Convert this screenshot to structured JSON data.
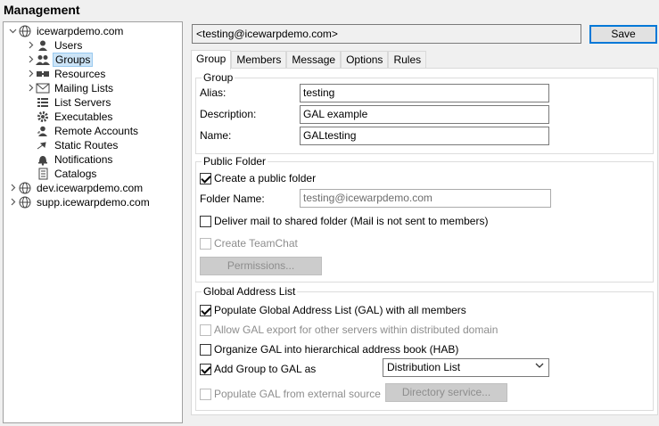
{
  "title": "Management",
  "tree": [
    {
      "label": "icewarpdemo.com",
      "icon": "globe-icon",
      "expanded": true
    },
    {
      "label": "Users",
      "icon": "user-icon"
    },
    {
      "label": "Groups",
      "icon": "group-icon",
      "selected": true
    },
    {
      "label": "Resources",
      "icon": "resources-icon"
    },
    {
      "label": "Mailing Lists",
      "icon": "mail-icon"
    },
    {
      "label": "List Servers",
      "icon": "list-icon"
    },
    {
      "label": "Executables",
      "icon": "gear-icon"
    },
    {
      "label": "Remote Accounts",
      "icon": "remote-user-icon"
    },
    {
      "label": "Static Routes",
      "icon": "arrow-icon"
    },
    {
      "label": "Notifications",
      "icon": "bell-icon"
    },
    {
      "label": "Catalogs",
      "icon": "catalog-icon"
    },
    {
      "label": "dev.icewarpdemo.com",
      "icon": "globe-icon"
    },
    {
      "label": "supp.icewarpdemo.com",
      "icon": "globe-icon"
    }
  ],
  "header": {
    "account": "<testing@icewarpdemo.com>",
    "save_label": "Save"
  },
  "tabs": [
    "Group",
    "Members",
    "Message",
    "Options",
    "Rules"
  ],
  "group_section": {
    "legend": "Group",
    "alias_label": "Alias:",
    "alias_value": "testing",
    "description_label": "Description:",
    "description_value": "GAL example",
    "name_label": "Name:",
    "name_value": "GALtesting"
  },
  "public_folder": {
    "legend": "Public Folder",
    "create_label": "Create a public folder",
    "folder_name_label": "Folder Name:",
    "folder_name_value": "testing@icewarpdemo.com",
    "deliver_label": "Deliver mail to shared folder (Mail is not sent to members)",
    "teamchat_label": "Create TeamChat",
    "permissions_label": "Permissions..."
  },
  "gal": {
    "legend": "Global Address List",
    "populate_label": "Populate Global Address List (GAL) with all members",
    "allow_export_label": "Allow GAL export for other servers within distributed domain",
    "hab_label": "Organize GAL into hierarchical address book (HAB)",
    "add_group_label": "Add Group to GAL as",
    "add_group_value": "Distribution List",
    "external_label": "Populate GAL from external source",
    "directory_label": "Directory service..."
  }
}
